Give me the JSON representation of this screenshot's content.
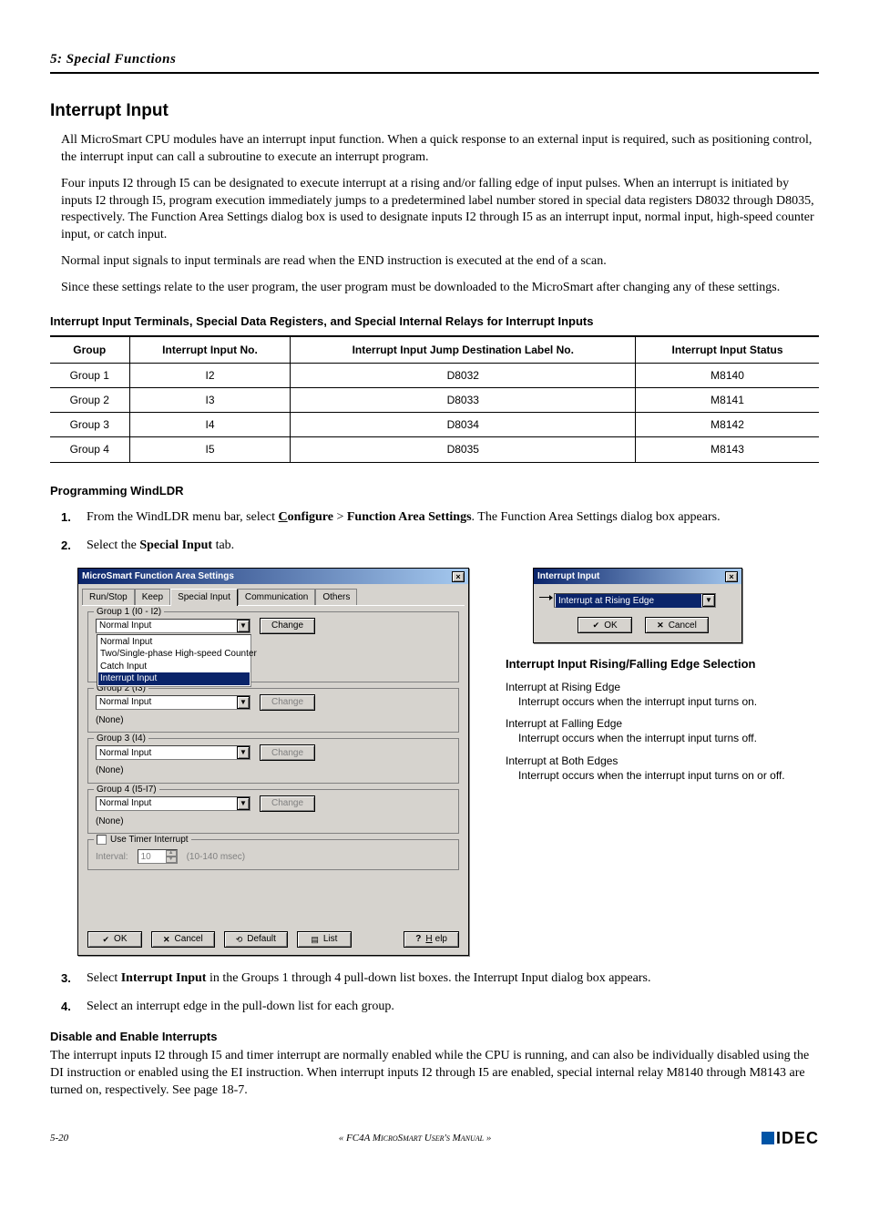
{
  "chapter": "5: Special Functions",
  "section_title": "Interrupt Input",
  "paragraphs": {
    "p1": "All MicroSmart CPU modules have an interrupt input function. When a quick response to an external input is required, such as positioning control, the interrupt input can call a subroutine to execute an interrupt program.",
    "p2": "Four inputs I2 through I5 can be designated to execute interrupt at a rising and/or falling edge of input pulses. When an interrupt is initiated by inputs I2 through I5, program execution immediately jumps to a predetermined label number stored in special data registers D8032 through D8035, respectively. The Function Area Settings dialog box is used to designate inputs I2 through I5 as an interrupt input, normal input, high-speed counter input, or catch input.",
    "p3": "Normal input signals to input terminals are read when the END instruction is executed at the end of a scan.",
    "p4": "Since these settings relate to the user program, the user program must be downloaded to the MicroSmart after changing any of these settings."
  },
  "table_caption": "Interrupt Input Terminals, Special Data Registers, and Special Internal Relays for Interrupt Inputs",
  "table": {
    "headers": [
      "Group",
      "Interrupt Input No.",
      "Interrupt Input Jump Destination Label No.",
      "Interrupt Input Status"
    ],
    "rows": [
      [
        "Group 1",
        "I2",
        "D8032",
        "M8140"
      ],
      [
        "Group 2",
        "I3",
        "D8033",
        "M8141"
      ],
      [
        "Group 3",
        "I4",
        "D8034",
        "M8142"
      ],
      [
        "Group 4",
        "I5",
        "D8035",
        "M8143"
      ]
    ]
  },
  "prog_heading": "Programming WindLDR",
  "steps": {
    "s1": "From the WindLDR menu bar, select Configure > Function Area Settings. The Function Area Settings dialog box appears.",
    "s1_pre": "From the WindLDR menu bar, select ",
    "s1_cfg": "Configure",
    "s1_gt": " > ",
    "s1_fas": "Function Area Settings",
    "s1_post": ". The Function Area Settings dialog box appears.",
    "s2_pre": "Select the ",
    "s2_b": "Special Input",
    "s2_post": " tab.",
    "s3_pre": "Select ",
    "s3_b": "Interrupt Input",
    "s3_post": " in the Groups 1 through 4 pull-down list boxes. the Interrupt Input dialog box appears.",
    "s4": "Select an interrupt edge in the pull-down list for each group."
  },
  "main_dialog": {
    "title": "MicroSmart Function Area Settings",
    "tabs": [
      "Run/Stop",
      "Keep",
      "Special Input",
      "Communication",
      "Others"
    ],
    "groups": {
      "g1": {
        "legend": "Group 1 (I0 - I2)",
        "value": "Normal Input",
        "status": "",
        "options": [
          "Normal Input",
          "Two/Single-phase High-speed Counter",
          "Catch Input",
          "Interrupt Input"
        ]
      },
      "g2": {
        "legend": "Group 2 (I3)",
        "value": "Normal Input",
        "status": "(None)"
      },
      "g3": {
        "legend": "Group 3 (I4)",
        "value": "Normal Input",
        "status": "(None)"
      },
      "g4": {
        "legend": "Group 4 (I5-I7)",
        "value": "Normal Input",
        "status": "(None)"
      }
    },
    "timer": {
      "label": "Use Timer Interrupt",
      "interval_label": "Interval:",
      "interval_value": "10",
      "unit": "(10-140 msec)"
    },
    "buttons": {
      "ok": "OK",
      "cancel": "Cancel",
      "default": "Default",
      "list": "List",
      "help": "Help"
    },
    "change": "Change"
  },
  "small_dialog": {
    "title": "Interrupt Input",
    "value": "Interrupt at Rising Edge",
    "ok": "OK",
    "cancel": "Cancel"
  },
  "edge_heading": "Interrupt Input Rising/Falling Edge Selection",
  "edges": [
    {
      "t": "Interrupt at Rising Edge",
      "d": "Interrupt occurs when the interrupt input turns on."
    },
    {
      "t": "Interrupt at Falling Edge",
      "d": "Interrupt occurs when the interrupt input turns off."
    },
    {
      "t": "Interrupt at Both Edges",
      "d": "Interrupt occurs when the interrupt input turns on or off."
    }
  ],
  "disable_heading": "Disable and Enable Interrupts",
  "disable_p": "The interrupt inputs I2 through I5 and timer interrupt are normally enabled while the CPU is running, and can also be individually disabled using the DI instruction or enabled using the EI instruction. When interrupt inputs I2 through I5 are enabled, special internal relay M8140 through M8143 are turned on, respectively. See page 18-7.",
  "footer": {
    "page": "5-20",
    "manual": "« FC4A MicroSmart User's Manual »",
    "brand": "IDEC"
  }
}
